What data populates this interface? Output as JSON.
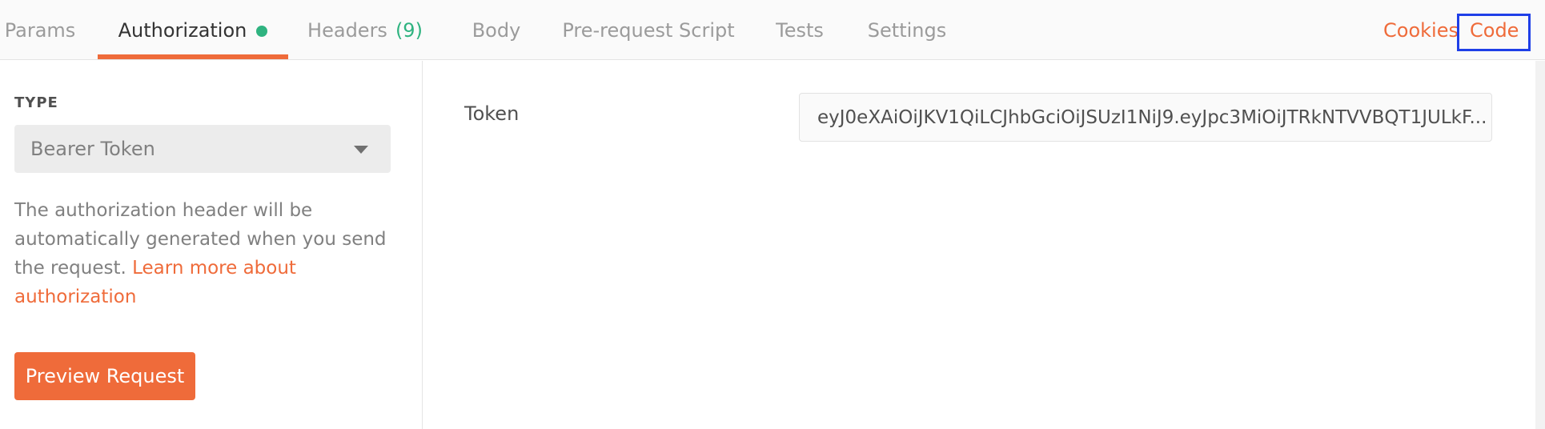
{
  "tabs": [
    {
      "label": "Params"
    },
    {
      "label": "Authorization",
      "has_status_dot": true
    },
    {
      "label": "Headers",
      "count": "(9)"
    },
    {
      "label": "Body"
    },
    {
      "label": "Pre-request Script"
    },
    {
      "label": "Tests"
    },
    {
      "label": "Settings"
    }
  ],
  "active_tab": "Authorization",
  "links": {
    "cookies": "Cookies",
    "code": "Code"
  },
  "auth": {
    "type_label": "TYPE",
    "selected_type": "Bearer Token",
    "help_text": "The authorization header will be automatically generated when you send the request. ",
    "help_link": "Learn more about authorization",
    "preview_button": "Preview Request"
  },
  "token": {
    "label": "Token",
    "value": "eyJ0eXAiOiJKV1QiLCJhbGciOiJSUzI1NiJ9.eyJpc3MiOiJTRkNTVVBQT1JULkF..."
  },
  "colors": {
    "accent": "#ef6b3a",
    "status_green": "#2fb380",
    "highlight_blue": "#1f3fe8"
  },
  "icons": {
    "status": "green-dot",
    "dropdown": "chevron-down-icon"
  }
}
